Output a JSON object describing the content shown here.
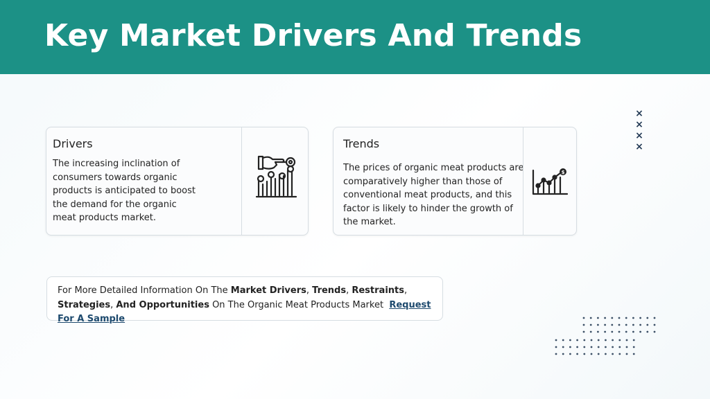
{
  "header": {
    "title": "Key Market Drivers And Trends"
  },
  "drivers_card": {
    "heading": "Drivers",
    "body": "The increasing inclination of consumers towards organic products is anticipated to boost the demand for the organic meat products market.",
    "icon": "hand-pointing-chart-icon"
  },
  "trends_card": {
    "heading": "Trends",
    "body": "The prices of organic meat products are comparatively higher than those of conventional meat products, and this factor is likely to hinder the growth of the market.",
    "icon": "rising-chart-dollar-icon"
  },
  "info_box": {
    "t1": "For More Detailed Information On The ",
    "b1": "Market Drivers",
    "t2": ", ",
    "b2": "Trends",
    "t3": ", ",
    "b3": "Restraints",
    "t4": ", ",
    "b4": "Strategies",
    "t5": ", ",
    "b5": "And Opportunities",
    "t6": " On The Organic Meat Products Market  ",
    "link": "Request For A Sample"
  },
  "decor": {
    "x_marks": [
      "×",
      "×",
      "×",
      "×"
    ]
  },
  "colors": {
    "header": "#1c9186",
    "accent_dark": "#233a55",
    "link": "#1e4a6e"
  }
}
